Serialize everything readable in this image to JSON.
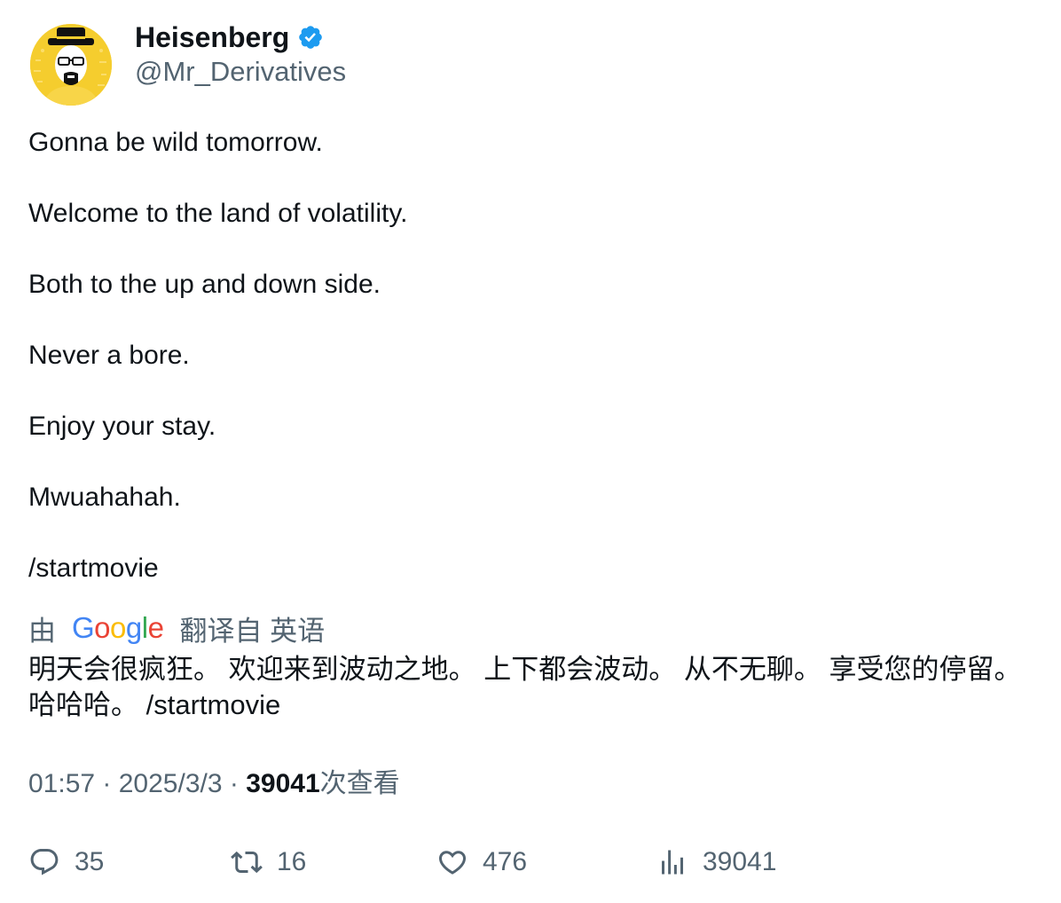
{
  "author": {
    "display_name": "Heisenberg",
    "handle": "@Mr_Derivatives",
    "verified": true,
    "avatar_icon": "heisenberg-avatar"
  },
  "tweet": {
    "lines": [
      "Gonna be wild tomorrow.",
      "Welcome to the land of volatility.",
      "Both to the up and down side.",
      "Never a bore.",
      "Enjoy your stay.",
      "Mwuahahah.",
      "/startmovie"
    ]
  },
  "translation": {
    "by_label": "由",
    "provider": "Google",
    "from_label": "翻译自 英语",
    "text": "明天会很疯狂。 欢迎来到波动之地。 上下都会波动。 从不无聊。 享受您的停留。 哈哈哈。 /startmovie"
  },
  "meta": {
    "time": "01:57",
    "separator": " · ",
    "date": "2025/3/3",
    "views": "39041",
    "views_suffix": "次查看"
  },
  "actions": {
    "replies": "35",
    "retweets": "16",
    "likes": "476",
    "views": "39041"
  },
  "colors": {
    "text": "#0f1419",
    "secondary": "#536471",
    "verified_badge": "#1d9bf0",
    "avatar_bg": "#f5cd2e"
  }
}
